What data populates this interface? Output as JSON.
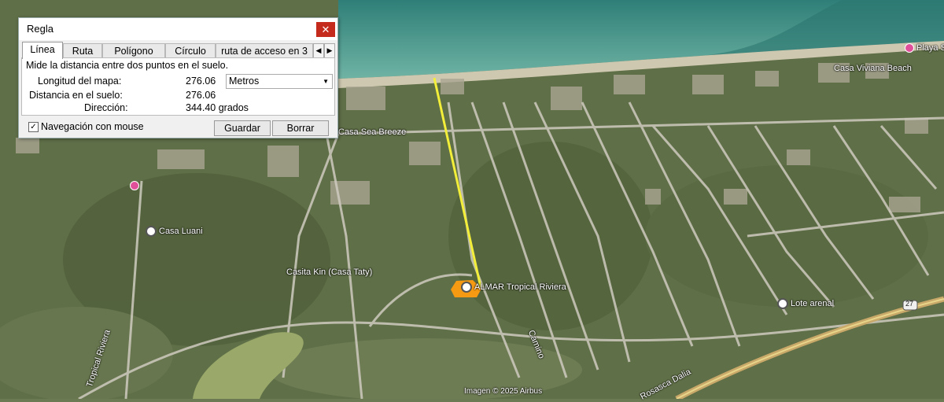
{
  "dialog": {
    "title": "Regla",
    "close_label": "✕",
    "tabs": [
      {
        "label": "Línea",
        "active": true
      },
      {
        "label": "Ruta"
      },
      {
        "label": "Polígono"
      },
      {
        "label": "Círculo"
      },
      {
        "label": "ruta de acceso en 3"
      }
    ],
    "description": "Mide la distancia entre dos puntos en el suelo.",
    "map_length_label": "Longitud del mapa:",
    "map_length_value": "276.06",
    "unit_selected": "Metros",
    "ground_distance_label": "Distancia en el suelo:",
    "ground_distance_value": "276.06",
    "direction_label": "Dirección:",
    "direction_value": "344.40 grados",
    "mouse_nav_label": "Navegación con mouse",
    "mouse_nav_checked": true,
    "save_label": "Guardar",
    "clear_label": "Borrar"
  },
  "map": {
    "labels": {
      "casa_luani": "Casa Luani",
      "casita": "Casita Kin (Casa Taty)",
      "almar": "ALMAR Tropical Riviera",
      "lote_arenal": "Lote arenal",
      "tropical_riviera": "Tropical Riviera",
      "rosasca_dalia": "Rosasca Dalia",
      "casa_viviana": "Casa Viviana Beach",
      "playa": "Playa S",
      "casa_sea_breeze": "Casa Sea Breeze",
      "camino": "Camino",
      "copyright": "Imagen © 2025 Airbus",
      "route_27": "27"
    },
    "measure_line_color": "#f2ee3a",
    "parcel_color": "#f59a12"
  }
}
